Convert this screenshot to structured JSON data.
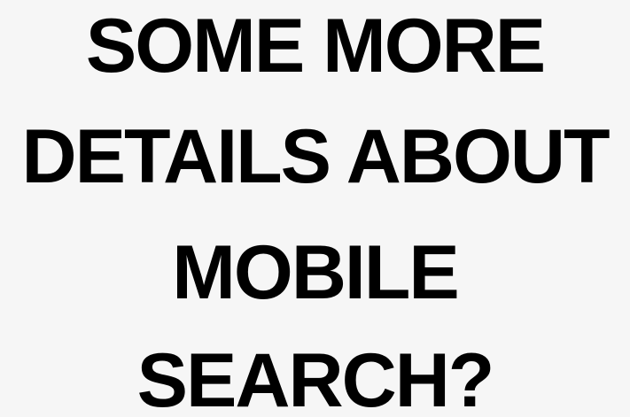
{
  "slide": {
    "headline_lines": [
      "SOME MORE",
      "DETAILS ABOUT",
      "MOBILE",
      "SEARCH?"
    ]
  },
  "colors": {
    "background": "#f6f6f6",
    "text": "#000000"
  }
}
